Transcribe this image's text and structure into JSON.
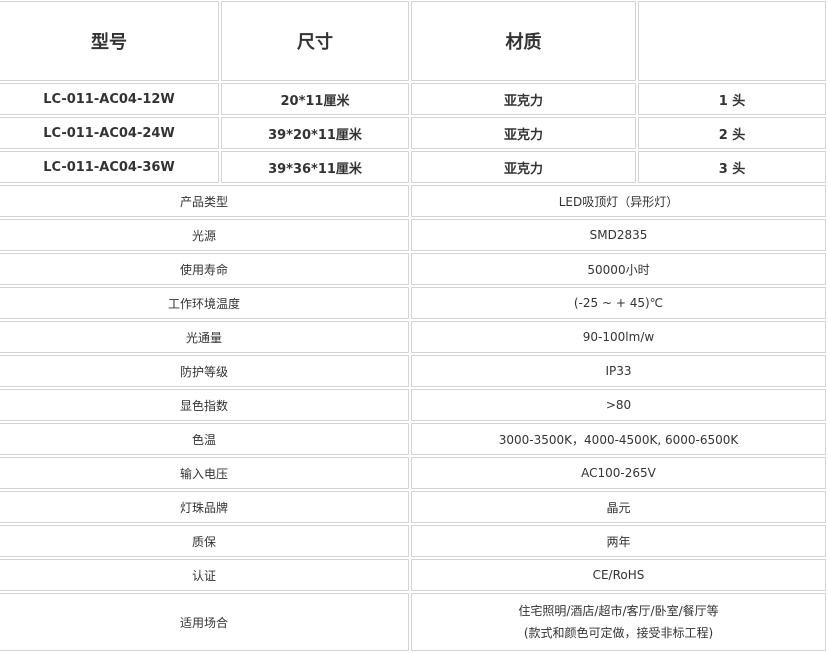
{
  "header": {
    "model": "型号",
    "size": "尺寸",
    "material": "材质",
    "heads": ""
  },
  "models": [
    {
      "model": "LC-011-AC04-12W",
      "size": "20*11厘米",
      "material": "亚克力",
      "heads": "1 头"
    },
    {
      "model": "LC-011-AC04-24W",
      "size": "39*20*11厘米",
      "material": "亚克力",
      "heads": "2 头"
    },
    {
      "model": "LC-011-AC04-36W",
      "size": "39*36*11厘米",
      "material": "亚克力",
      "heads": "3 头"
    }
  ],
  "specs": [
    {
      "label": "产品类型",
      "value": "LED吸顶灯（异形灯）"
    },
    {
      "label": "光源",
      "value": "SMD2835"
    },
    {
      "label": "使用寿命",
      "value": "50000小时"
    },
    {
      "label": "工作环境温度",
      "value": "(-25 ~ + 45)℃"
    },
    {
      "label": "光通量",
      "value": "90-100lm/w"
    },
    {
      "label": "防护等级",
      "value": "IP33"
    },
    {
      "label": "显色指数",
      "value": ">80"
    },
    {
      "label": "色温",
      "value": "3000-3500K，4000-4500K, 6000-6500K"
    },
    {
      "label": "输入电压",
      "value": "AC100-265V"
    },
    {
      "label": "灯珠品牌",
      "value": "晶元"
    },
    {
      "label": "质保",
      "value": "两年"
    },
    {
      "label": "认证",
      "value": "CE/RoHS"
    }
  ],
  "usage": {
    "label": "适用场合",
    "line1": "住宅照明/酒店/超市/客厅/卧室/餐厅等",
    "line2": "(款式和颜色可定做，接受非标工程)"
  }
}
